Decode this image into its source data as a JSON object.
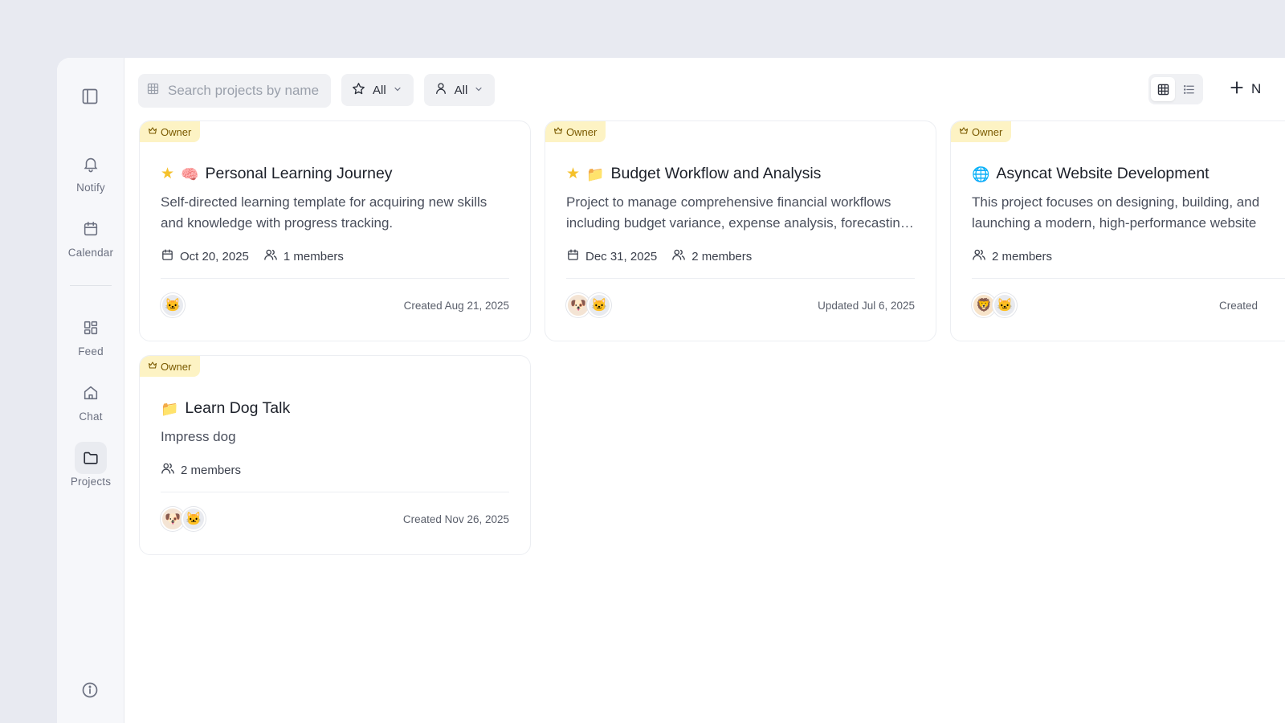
{
  "sidebar": {
    "items": [
      {
        "label": "Notify",
        "icon": "bell-icon"
      },
      {
        "label": "Calendar",
        "icon": "calendar-icon"
      },
      {
        "label": "Feed",
        "icon": "grid-icon"
      },
      {
        "label": "Chat",
        "icon": "home-icon"
      },
      {
        "label": "Projects",
        "icon": "folder-icon",
        "active": true
      }
    ]
  },
  "toolbar": {
    "search_placeholder": "Search projects by name",
    "star_filter": "All",
    "member_filter": "All",
    "new_label": "N"
  },
  "projects": [
    {
      "badge": "Owner",
      "starred": true,
      "emoji": "🧠",
      "title": "Personal Learning Journey",
      "desc_line1": "Self-directed learning template for acquiring new skills",
      "desc_line2": "and knowledge with progress tracking.",
      "date": "Oct 20, 2025",
      "members": "1 members",
      "avatars": [
        "🐱"
      ],
      "stamp": "Created Aug 21, 2025"
    },
    {
      "badge": "Owner",
      "starred": true,
      "emoji": "📁",
      "title": "Budget Workflow and Analysis",
      "desc_line1": "Project to manage comprehensive financial workflows",
      "desc_line2": "including budget variance, expense analysis, forecasting and reporting",
      "date": "Dec 31, 2025",
      "members": "2 members",
      "avatars": [
        "🐶",
        "🐱"
      ],
      "stamp": "Updated Jul 6, 2025"
    },
    {
      "badge": "Owner",
      "starred": false,
      "emoji": "🌐",
      "title": "Asyncat Website Development",
      "desc_line1": "This project focuses on designing, building, and",
      "desc_line2": "launching a modern, high-performance website",
      "members": "2 members",
      "avatars": [
        "🦁",
        "🐱"
      ],
      "stamp": "Created"
    },
    {
      "badge": "Owner",
      "starred": false,
      "emoji": "📁",
      "title": "Learn Dog Talk",
      "desc_line1": "Impress dog",
      "members": "2 members",
      "avatars": [
        "🐶",
        "🐱"
      ],
      "stamp": "Created Nov 26, 2025"
    }
  ]
}
